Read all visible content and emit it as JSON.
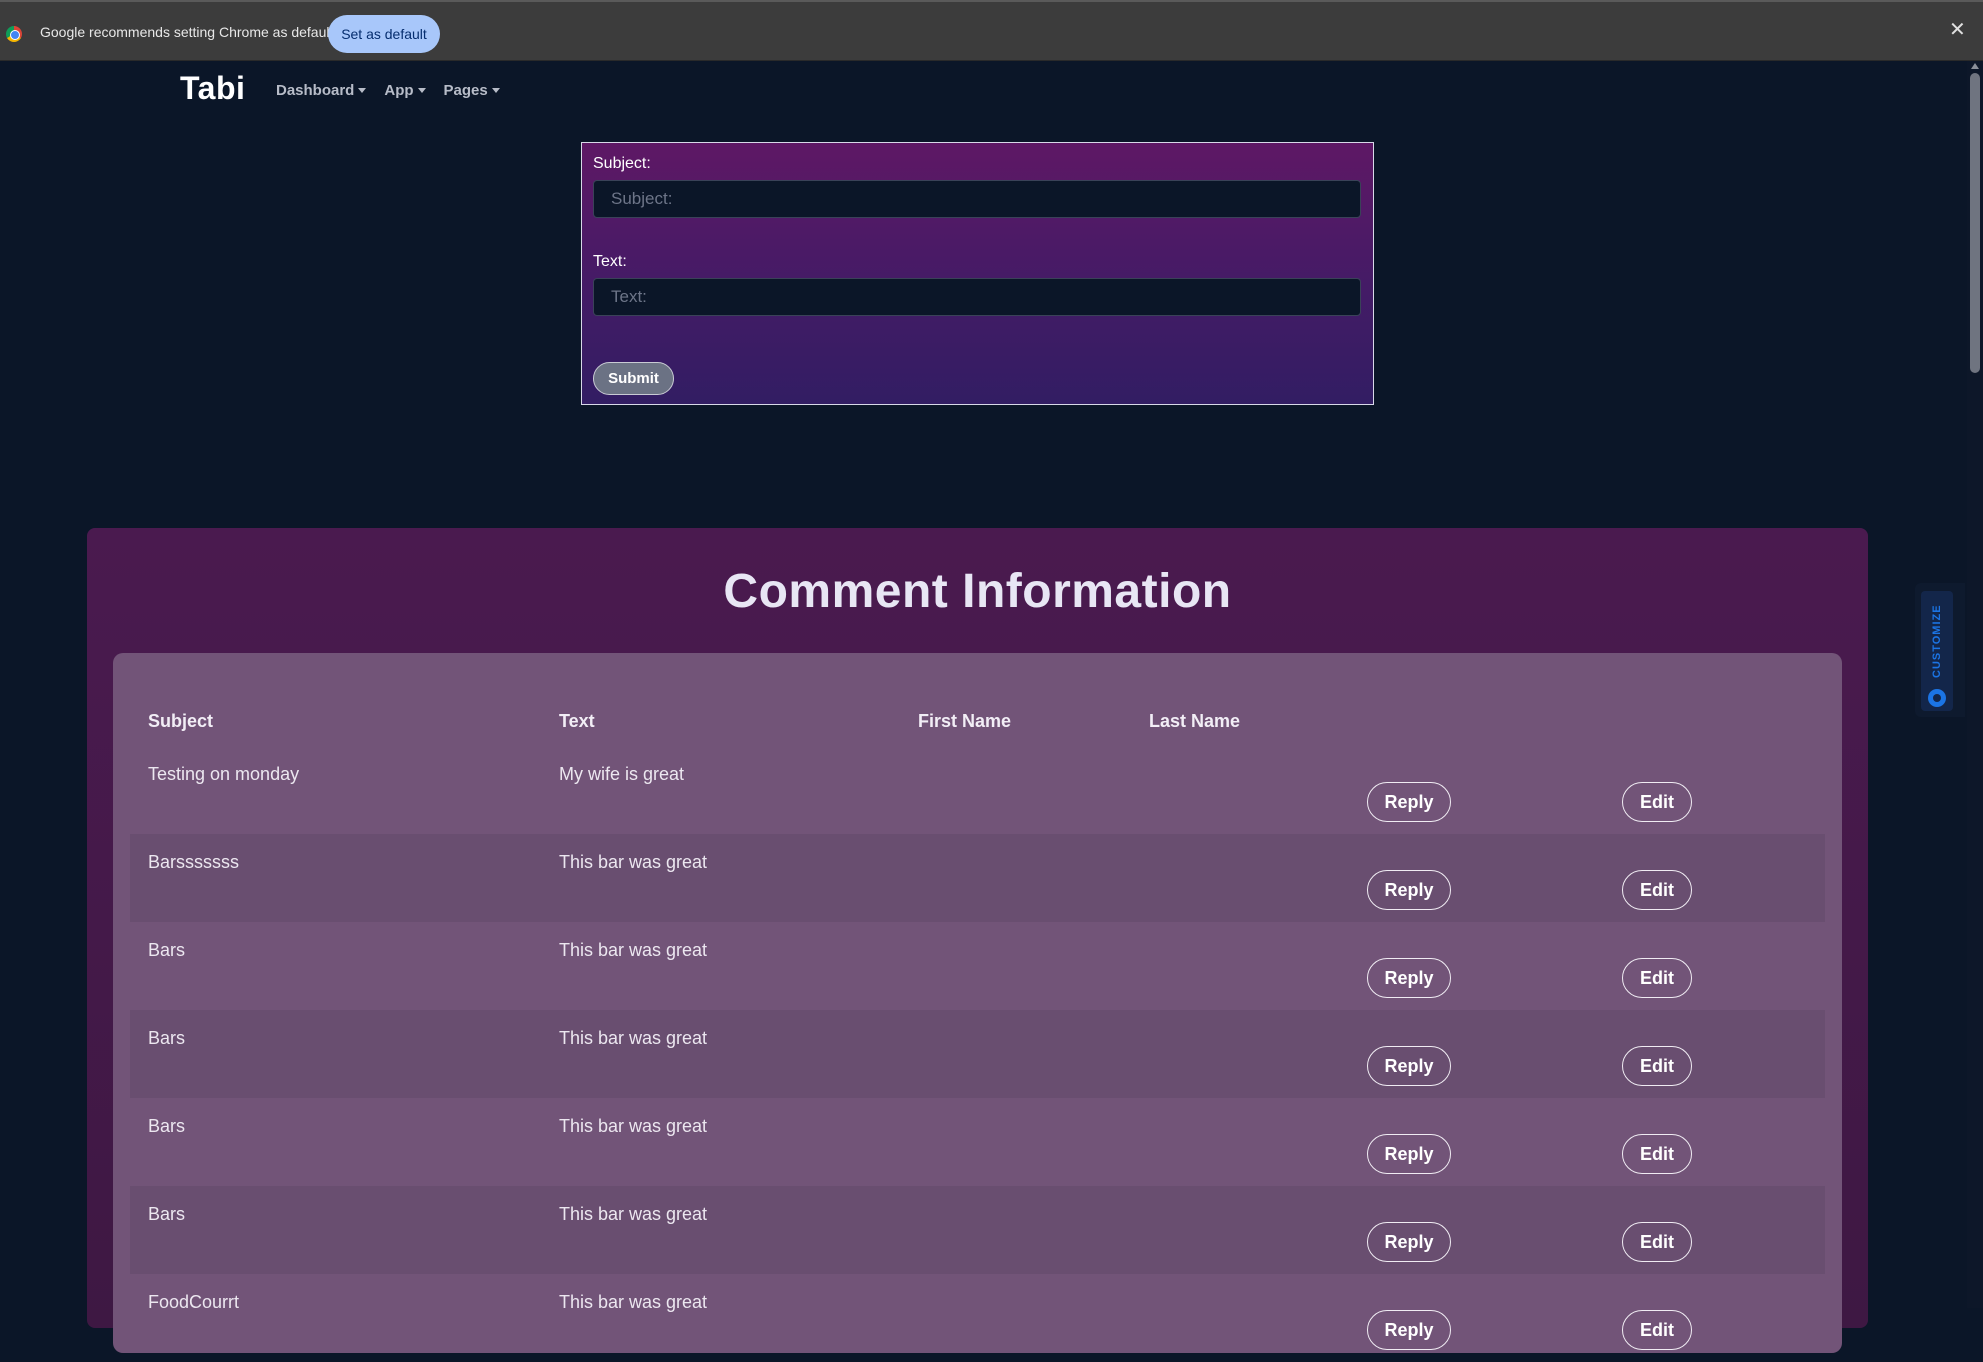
{
  "infobar": {
    "message": "Google recommends setting Chrome as default",
    "set_default_label": "Set as default",
    "close_glyph": "✕"
  },
  "nav": {
    "brand": "Tabi",
    "items": [
      {
        "label": "Dashboard"
      },
      {
        "label": "App"
      },
      {
        "label": "Pages"
      }
    ]
  },
  "form": {
    "subject_label": "Subject:",
    "subject_placeholder": "Subject:",
    "text_label": "Text:",
    "text_placeholder": "Text:",
    "submit_label": "Submit"
  },
  "customize": {
    "label": "CUSTOMIZE",
    "icon": "gear-icon"
  },
  "comments": {
    "title": "Comment Information",
    "columns": [
      "Subject",
      "Text",
      "First Name",
      "Last Name"
    ],
    "reply_label": "Reply",
    "edit_label": "Edit",
    "rows": [
      {
        "subject": "Testing on monday",
        "text": "My wife is great",
        "first_name": "",
        "last_name": ""
      },
      {
        "subject": "Barsssssss",
        "text": "This bar was great",
        "first_name": "",
        "last_name": ""
      },
      {
        "subject": "Bars",
        "text": "This bar was great",
        "first_name": "",
        "last_name": ""
      },
      {
        "subject": "Bars",
        "text": "This bar was great",
        "first_name": "",
        "last_name": ""
      },
      {
        "subject": "Bars",
        "text": "This bar was great",
        "first_name": "",
        "last_name": ""
      },
      {
        "subject": "Bars",
        "text": "This bar was great",
        "first_name": "",
        "last_name": ""
      },
      {
        "subject": "FoodCourrt",
        "text": "This bar was great",
        "first_name": "",
        "last_name": ""
      }
    ]
  },
  "colors": {
    "page_bg": "#0b1628",
    "infobar_bg": "#3c3c3c",
    "accent_button": "#a8c7fa",
    "card_bg": "#4a1a4f",
    "table_bg": "#725478",
    "customize_accent": "#1b74e4"
  }
}
